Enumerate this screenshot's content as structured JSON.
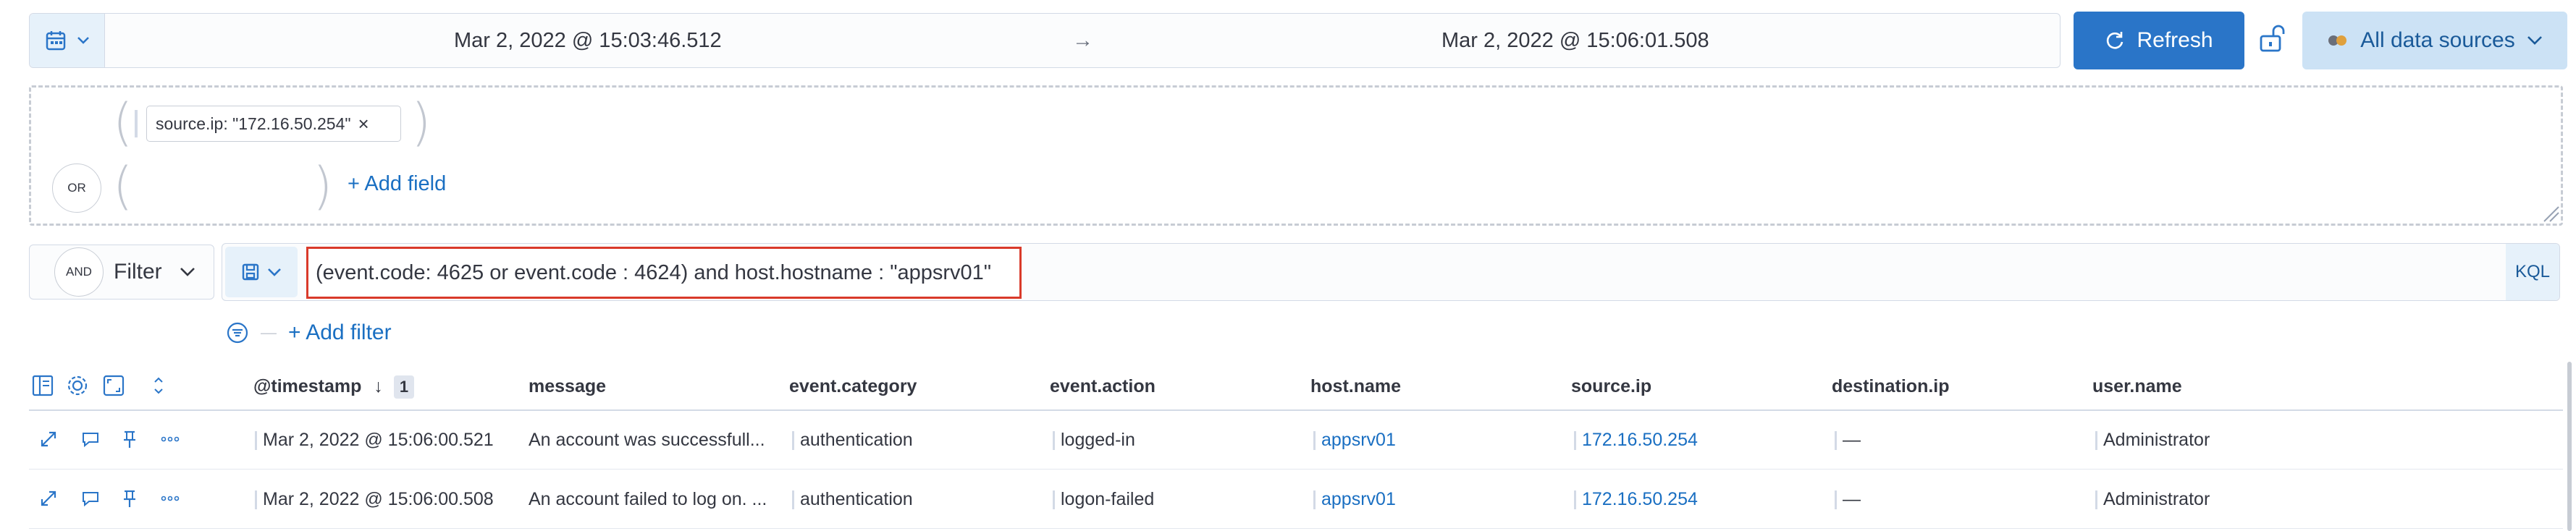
{
  "date_picker": {
    "start": "Mar 2, 2022 @ 15:03:46.512",
    "arrow": "→",
    "end": "Mar 2, 2022 @ 15:06:01.508",
    "refresh_label": "Refresh",
    "data_sources_label": "All data sources"
  },
  "query_builder": {
    "chip_label": "source.ip: \"172.16.50.254\"",
    "chip_close": "×",
    "or_label": "OR",
    "add_field_label": "+ Add field"
  },
  "filter_bar": {
    "and_label": "AND",
    "filter_label": "Filter",
    "query": "(event.code: 4625 or event.code : 4624) and host.hostname : \"appsrv01\"",
    "language_label": "KQL",
    "add_filter_label": "+ Add filter",
    "filter_separator": "—"
  },
  "table": {
    "sort_arrow": "↓",
    "sort_count": "1",
    "columns": [
      "@timestamp",
      "message",
      "event.category",
      "event.action",
      "host.name",
      "source.ip",
      "destination.ip",
      "user.name"
    ],
    "rows": [
      {
        "timestamp": "Mar 2, 2022 @ 15:06:00.521",
        "message": "An account was successfull...",
        "category": "authentication",
        "action": "logged-in",
        "host": "appsrv01",
        "source_ip": "172.16.50.254",
        "dest_ip": "—",
        "user": "Administrator"
      },
      {
        "timestamp": "Mar 2, 2022 @ 15:06:00.508",
        "message": "An account failed to log on. ...",
        "category": "authentication",
        "action": "logon-failed",
        "host": "appsrv01",
        "source_ip": "172.16.50.254",
        "dest_ip": "—",
        "user": "Administrator"
      }
    ]
  },
  "colors": {
    "accent": "#2a75c8",
    "link": "#1a6fc2",
    "highlight_border": "#d93a2a"
  }
}
